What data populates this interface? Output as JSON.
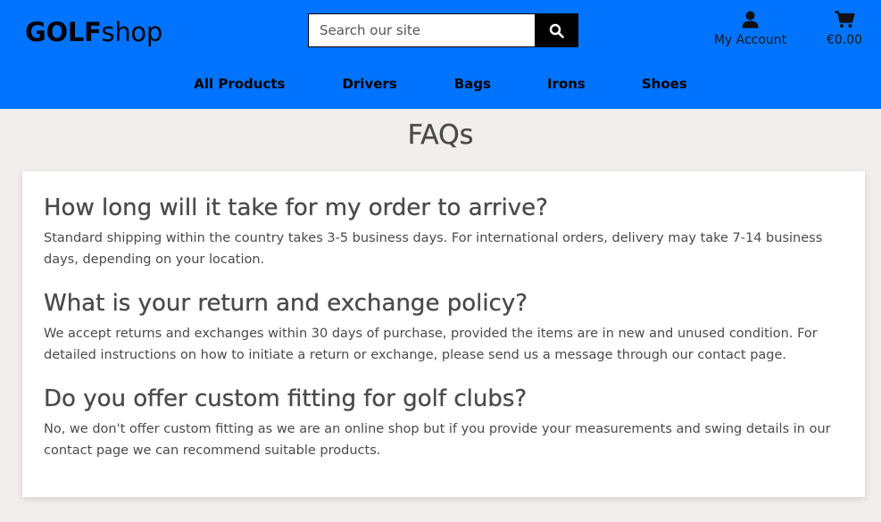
{
  "header": {
    "logo_bold": "GOLF",
    "logo_rest": "shop",
    "search_placeholder": "Search our site",
    "account_label": "My Account",
    "cart_total": "€0.00",
    "colors": {
      "bar": "#0073ff",
      "search_button": "#000000"
    },
    "icons": {
      "search": "search-icon",
      "account": "user-icon",
      "cart": "cart-icon"
    }
  },
  "nav": {
    "items": [
      {
        "label": "All Products"
      },
      {
        "label": "Drivers"
      },
      {
        "label": "Bags"
      },
      {
        "label": "Irons"
      },
      {
        "label": "Shoes"
      }
    ]
  },
  "main": {
    "title": "FAQs",
    "faqs": [
      {
        "question": "How long will it take for my order to arrive?",
        "answer": "Standard shipping within the country takes 3-5 business days. For international orders, delivery may take 7-14 business days, depending on your location."
      },
      {
        "question": "What is your return and exchange policy?",
        "answer": "We accept returns and exchanges within 30 days of purchase, provided the items are in new and unused condition. For detailed instructions on how to initiate a return or exchange, please send us a message through our contact page."
      },
      {
        "question": "Do you offer custom fitting for golf clubs?",
        "answer": "No, we don't offer custom fitting as we are an online shop but if you provide your measurements and swing details in our contact page we can recommend suitable products."
      }
    ]
  }
}
